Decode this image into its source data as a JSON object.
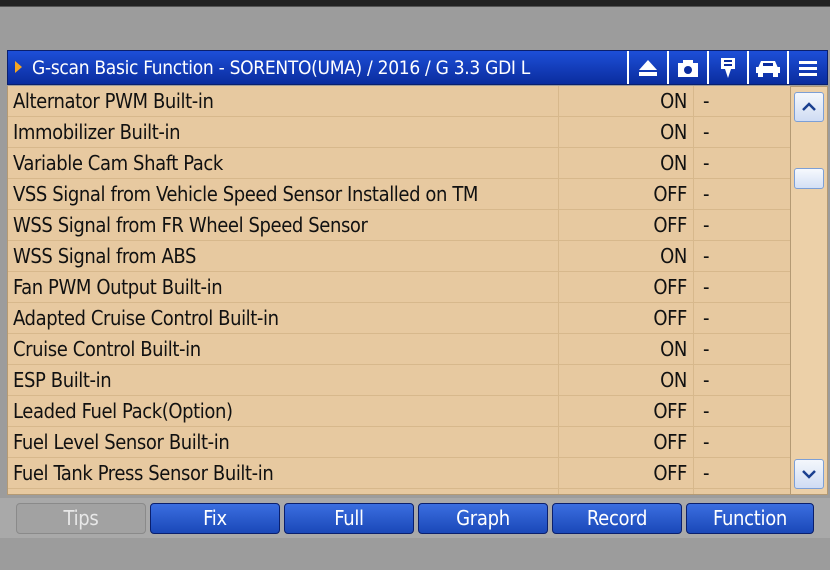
{
  "window": {
    "title": "G-scan Basic Function - SORENTO(UMA) / 2016 / G 3.3 GDI L",
    "icons": [
      "eject-icon",
      "camera-icon",
      "pin-icon",
      "car-icon",
      "menu-icon"
    ]
  },
  "table": {
    "rows": [
      {
        "name": "Alternator PWM Built-in",
        "value": "ON",
        "unit": "-"
      },
      {
        "name": "Immobilizer Built-in",
        "value": "ON",
        "unit": "-"
      },
      {
        "name": "Variable Cam Shaft Pack",
        "value": "ON",
        "unit": "-"
      },
      {
        "name": "VSS Signal from Vehicle Speed Sensor Installed on TM",
        "value": "OFF",
        "unit": "-"
      },
      {
        "name": "WSS Signal from FR Wheel Speed Sensor",
        "value": "OFF",
        "unit": "-"
      },
      {
        "name": "WSS Signal from ABS",
        "value": "ON",
        "unit": "-"
      },
      {
        "name": "Fan PWM Output Built-in",
        "value": "OFF",
        "unit": "-"
      },
      {
        "name": "Adapted Cruise Control Built-in",
        "value": "OFF",
        "unit": "-"
      },
      {
        "name": "Cruise Control Built-in",
        "value": "ON",
        "unit": "-"
      },
      {
        "name": "ESP Built-in",
        "value": "ON",
        "unit": "-"
      },
      {
        "name": "Leaded Fuel Pack(Option)",
        "value": "OFF",
        "unit": "-"
      },
      {
        "name": "Fuel Level Sensor Built-in",
        "value": "OFF",
        "unit": "-"
      },
      {
        "name": "Fuel Tank Press Sensor Built-in",
        "value": "OFF",
        "unit": "-"
      }
    ]
  },
  "buttons": {
    "tips": "Tips",
    "fix": "Fix",
    "full": "Full",
    "graph": "Graph",
    "record": "Record",
    "function": "Function"
  }
}
